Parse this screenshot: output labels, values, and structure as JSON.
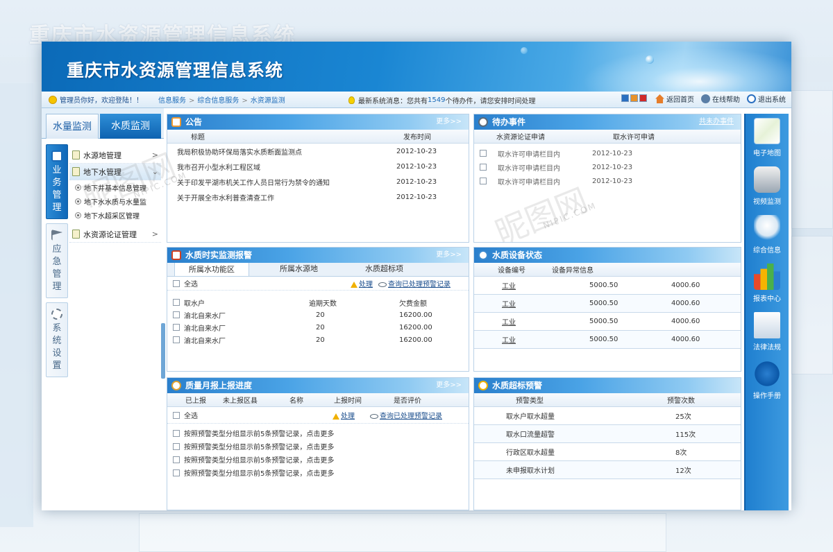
{
  "app": {
    "title": "重庆市水资源管理信息系统"
  },
  "topbar": {
    "welcome": "管理员你好，欢迎登陆！！",
    "breadcrumb": [
      "信息服务",
      "综合信息服务",
      "水资源监测"
    ],
    "notice_prefix": "最新系统消息：您共有",
    "notice_count": "1549",
    "notice_suffix": "个待办件，请您安排时间处理",
    "links": {
      "home": "返回首页",
      "help": "在线帮助",
      "logout": "退出系统"
    }
  },
  "nav": {
    "tabs": [
      "水量监测",
      "水质监测"
    ],
    "categories": [
      {
        "chars": [
          "业",
          "务",
          "管",
          "理"
        ]
      },
      {
        "chars": [
          "应",
          "急",
          "管",
          "理"
        ]
      },
      {
        "chars": [
          "系",
          "统",
          "设",
          "置"
        ]
      }
    ],
    "menu": {
      "item1": "水源地管理",
      "item2": "地下水管理",
      "sub": [
        "地下井基本信息管理",
        "地下水水质与水量监",
        "地下水超采区管理"
      ],
      "item3": "水资源论证管理"
    }
  },
  "rightbar": [
    "电子地图",
    "视频监测",
    "综合信息",
    "报表中心",
    "法律法规",
    "操作手册"
  ],
  "announcements": {
    "title": "公告",
    "more": "更多>>",
    "col_title": "标题",
    "col_time": "发布时间",
    "rows": [
      {
        "title": "我局积极协助环保局落实水质断面监测点",
        "time": "2012-10-23"
      },
      {
        "title": "我市召开小型水利工程区域",
        "time": "2012-10-23"
      },
      {
        "title": "关于印发平湖市机关工作人员日常行为禁令的通知",
        "time": "2012-10-23"
      },
      {
        "title": "关于开展全市水利普查清查工作",
        "time": "2012-10-23"
      }
    ]
  },
  "todo": {
    "title": "待办事件",
    "more": "未办事件",
    "more_prefix": "共",
    "tab1": "水资源论证申请",
    "tab2": "取水许可申请",
    "rows": [
      {
        "text": "取水许可申请栏目内",
        "time": "2012-10-23"
      },
      {
        "text": "取水许可申请栏目内",
        "time": "2012-10-23"
      },
      {
        "text": "取水许可申请栏目内",
        "time": "2012-10-23"
      }
    ]
  },
  "quality_alarm": {
    "title": "水质时实监测报警",
    "more": "更多>>",
    "tabs": [
      "所属水功能区",
      "所属水源地",
      "水质超标项"
    ],
    "select_all": "全选",
    "handle": "处理",
    "query": "查询已处理预警记录",
    "cols": [
      "取水户",
      "逾期天数",
      "欠费金额"
    ],
    "rows": [
      {
        "name": "渝北自来水厂",
        "days": "20",
        "amount": "16200.00"
      },
      {
        "name": "渝北自来水厂",
        "days": "20",
        "amount": "16200.00"
      },
      {
        "name": "渝北自来水厂",
        "days": "20",
        "amount": "16200.00"
      }
    ]
  },
  "device_status": {
    "title": "水质设备状态",
    "cols": [
      "设备编号",
      "设备异常信息"
    ],
    "rows": [
      {
        "id": "工业",
        "v1": "5000.50",
        "v2": "4000.60"
      },
      {
        "id": "工业",
        "v1": "5000.50",
        "v2": "4000.60"
      },
      {
        "id": "工业",
        "v1": "5000.50",
        "v2": "4000.60"
      },
      {
        "id": "工业",
        "v1": "5000.50",
        "v2": "4000.60"
      }
    ]
  },
  "monthly": {
    "title": "质量月报上报进度",
    "more": "更多>>",
    "cols": [
      "已上报",
      "未上报区县",
      "名称",
      "上报时间",
      "是否评价"
    ],
    "select_all": "全选",
    "handle": "处理",
    "query": "查询已处理预警记录",
    "rows": [
      "按照预警类型分组显示前5条预警记录，点击更多",
      "按照预警类型分组显示前5条预警记录，点击更多",
      "按照预警类型分组显示前5条预警记录，点击更多",
      "按照预警类型分组显示前5条预警记录，点击更多"
    ]
  },
  "overlimit": {
    "title": "水质超标预警",
    "cols": [
      "预警类型",
      "预警次数"
    ],
    "rows": [
      {
        "type": "取水户取水超量",
        "count": "25次"
      },
      {
        "type": "取水口流量超警",
        "count": "115次"
      },
      {
        "type": "行政区取水超量",
        "count": "8次"
      },
      {
        "type": "未申报取水计划",
        "count": "12次"
      }
    ]
  },
  "watermark": {
    "text": "昵图网",
    "url": "NIPIC.COM"
  }
}
